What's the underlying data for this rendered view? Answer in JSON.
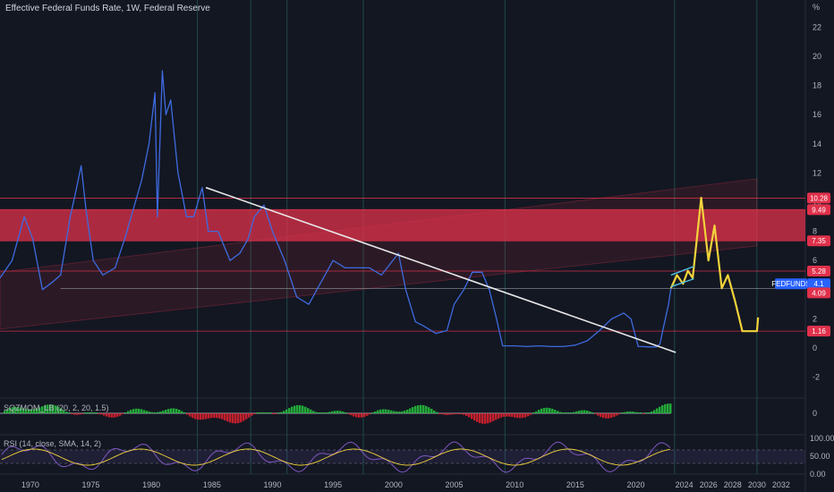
{
  "header": {
    "title": "Effective Federal Funds Rate, 1W, Federal Reserve",
    "unit": "%"
  },
  "indicators": {
    "sqzmom_label": "SQZMOM_LB (20, 2, 20, 1.5)",
    "rsi_label": "RSI (14, close, SMA, 14, 2)"
  },
  "colors": {
    "background": "#131722",
    "price_line": "#3e6be0",
    "forecast": "#f3d33b",
    "resistance_zone": "#e0314b",
    "trendline": "#e8e8e8",
    "channel": "#4fc3e8",
    "level_line": "#e0314b"
  },
  "price_badges": [
    {
      "label": "10.28",
      "value": 10.28,
      "color": "#e0314b"
    },
    {
      "label": "9.49",
      "value": 9.49,
      "color": "#e0314b"
    },
    {
      "label": "7.35",
      "value": 7.35,
      "color": "#e0314b"
    },
    {
      "label": "5.28",
      "value": 5.28,
      "color": "#e0314b"
    },
    {
      "label": "FEDFUNDS",
      "value": 4.1,
      "color": "#2962ff"
    },
    {
      "label": "4.1",
      "value": 4.1,
      "color": "#2962ff"
    },
    {
      "label": "4.09",
      "value": 4.09,
      "color": "#e0314b"
    },
    {
      "label": "1.16",
      "value": 1.16,
      "color": "#e0314b"
    }
  ],
  "indicator_axis": {
    "sqzmom_zero": "0",
    "rsi_ticks": [
      "100.00",
      "50.00",
      "0.00"
    ]
  },
  "chart_data": {
    "type": "line",
    "title": "Effective Federal Funds Rate, 1W, Federal Reserve",
    "ylabel": "%",
    "ylim": [
      -3,
      23
    ],
    "xlim": [
      1967.5,
      2034
    ],
    "x_ticks": [
      "1970",
      "1975",
      "1980",
      "1985",
      "1990",
      "1995",
      "2000",
      "2005",
      "2010",
      "2015",
      "2020",
      "2024",
      "2026",
      "2028",
      "2030",
      "2032"
    ],
    "y_ticks": [
      "22",
      "20",
      "18",
      "16",
      "14",
      "12",
      "10",
      "8",
      "6",
      "4",
      "2",
      "0",
      "-2"
    ],
    "grid": false,
    "series": [
      {
        "name": "FEDFUNDS",
        "x": [
          1967.5,
          1968.5,
          1969.5,
          1970.2,
          1971.0,
          1971.8,
          1972.5,
          1973.3,
          1973.7,
          1974.2,
          1974.6,
          1975.2,
          1976.0,
          1977.0,
          1977.8,
          1978.5,
          1979.2,
          1979.8,
          1980.3,
          1980.5,
          1980.9,
          1981.2,
          1981.6,
          1982.2,
          1982.9,
          1983.5,
          1984.2,
          1984.7,
          1985.5,
          1986.5,
          1987.3,
          1988.0,
          1988.5,
          1989.3,
          1990.0,
          1991.0,
          1992.0,
          1993.0,
          1994.0,
          1995.0,
          1996.0,
          1997.0,
          1998.0,
          1999.0,
          2000.4,
          2001.0,
          2001.8,
          2002.5,
          2003.5,
          2004.4,
          2005.0,
          2005.8,
          2006.5,
          2007.3,
          2007.9,
          2008.5,
          2009.0,
          2010.0,
          2011.0,
          2012.0,
          2013.0,
          2014.0,
          2015.0,
          2016.0,
          2017.0,
          2018.0,
          2019.0,
          2019.6,
          2020.2,
          2020.5,
          2021.0,
          2021.7,
          2022.0,
          2022.3,
          2022.7,
          2022.9
        ],
        "values": [
          4.8,
          6.0,
          9.0,
          7.5,
          4.0,
          4.5,
          5.0,
          9.0,
          10.5,
          12.5,
          9.5,
          6.0,
          5.0,
          5.5,
          7.5,
          9.5,
          11.5,
          14.0,
          17.5,
          9.0,
          19.0,
          16.0,
          17.0,
          12.0,
          9.0,
          9.0,
          11.0,
          8.0,
          8.0,
          6.0,
          6.5,
          7.5,
          9.0,
          9.8,
          8.0,
          6.0,
          3.5,
          3.0,
          4.5,
          6.0,
          5.5,
          5.5,
          5.5,
          5.0,
          6.5,
          4.0,
          1.8,
          1.5,
          1.0,
          1.2,
          3.0,
          4.0,
          5.2,
          5.2,
          4.0,
          2.0,
          0.15,
          0.15,
          0.1,
          0.15,
          0.1,
          0.1,
          0.2,
          0.5,
          1.2,
          2.0,
          2.4,
          2.0,
          0.1,
          0.1,
          0.08,
          0.08,
          0.3,
          1.5,
          3.0,
          4.1
        ]
      },
      {
        "x": [
          2022.9,
          2023.4,
          2023.9,
          2024.3,
          2024.7,
          2025.4,
          2026.0,
          2026.5,
          2027.1,
          2027.6,
          2028.2,
          2028.8,
          2030.0,
          2030.1
        ],
        "values": [
          4.1,
          5.0,
          4.4,
          5.3,
          4.8,
          10.3,
          6.0,
          8.4,
          4.1,
          5.0,
          3.2,
          1.16,
          1.16,
          2.1
        ]
      }
    ],
    "horizontal_levels": [
      10.28,
      9.49,
      7.35,
      5.28,
      4.09,
      1.16
    ],
    "zone": {
      "from": 7.35,
      "to": 9.49
    },
    "trendline": {
      "x": [
        1984.5,
        2023.3
      ],
      "values": [
        11.0,
        -0.3
      ]
    },
    "channel": {
      "x": [
        2022.9,
        2024.8
      ],
      "values_lower": [
        4.2,
        4.75
      ],
      "values_upper": [
        5.0,
        5.6
      ]
    },
    "panes": [
      {
        "name": "SQZMOM_LB (20, 2, 20, 1.5)",
        "type": "histogram",
        "zero_label": "0"
      },
      {
        "name": "RSI (14, close, SMA, 14, 2)",
        "type": "line",
        "ylim": [
          0,
          100
        ],
        "bands": [
          30,
          70
        ]
      }
    ]
  }
}
